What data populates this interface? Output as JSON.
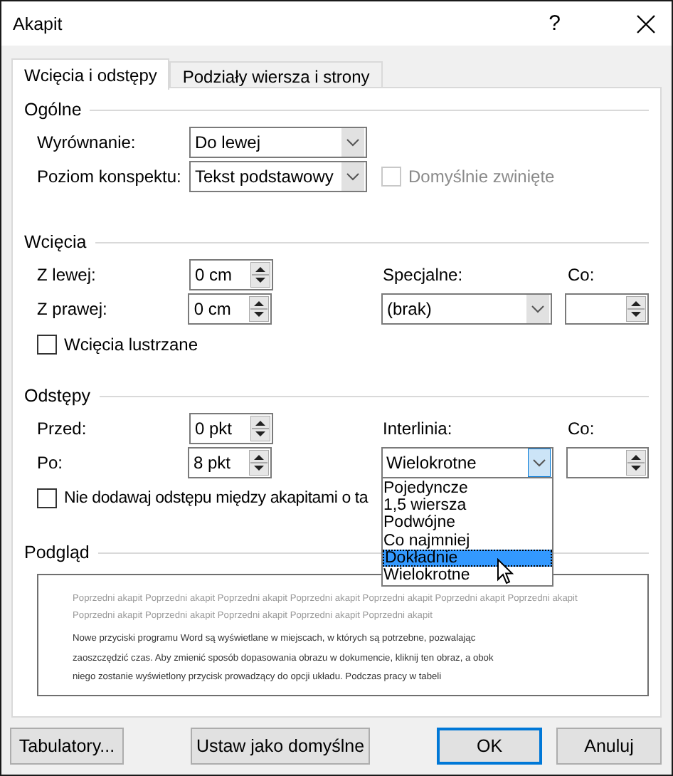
{
  "window": {
    "title": "Akapit",
    "help": "?"
  },
  "tabs": [
    {
      "label": "Wcięcia i odstępy",
      "selected": true
    },
    {
      "label": "Podziały wiersza i strony",
      "selected": false
    }
  ],
  "general": {
    "heading": "Ogólne",
    "alignment": {
      "label": "Wyrównanie:",
      "value": "Do lewej"
    },
    "outline_level": {
      "label": "Poziom konspektu:",
      "value": "Tekst podstawowy"
    },
    "collapsed_by_default": {
      "label": "Domyślnie zwinięte",
      "checked": false,
      "disabled": true
    }
  },
  "indentation": {
    "heading": "Wcięcia",
    "left": {
      "label": "Z lewej:",
      "value": "0 cm"
    },
    "right": {
      "label": "Z prawej:",
      "value": "0 cm"
    },
    "special": {
      "label": "Specjalne:",
      "value": "(brak)"
    },
    "by": {
      "label": "Co:"
    },
    "mirror_indents": {
      "label": "Wcięcia lustrzane",
      "checked": false
    }
  },
  "spacing": {
    "heading": "Odstępy",
    "before": {
      "label": "Przed:",
      "value": "0 pkt"
    },
    "after": {
      "label": "Po:",
      "value": "8 pkt"
    },
    "line_spacing": {
      "label": "Interlinia:",
      "value": "Wielokrotne",
      "expanded": true,
      "options": [
        {
          "label": "Pojedyncze",
          "highlighted": false
        },
        {
          "label": "1,5 wiersza",
          "highlighted": false
        },
        {
          "label": "Podwójne",
          "highlighted": false
        },
        {
          "label": "Co najmniej",
          "highlighted": false
        },
        {
          "label": "Dokładnie",
          "highlighted": true
        },
        {
          "label": "Wielokrotne",
          "highlighted": false
        }
      ]
    },
    "at": {
      "label": "Co:"
    },
    "no_space_same_style": {
      "label": "Nie dodawaj odstępu między akapitami o ta",
      "checked": false
    }
  },
  "preview": {
    "heading": "Podgląd",
    "previous_lines": [
      "Poprzedni akapit Poprzedni akapit Poprzedni akapit Poprzedni akapit Poprzedni akapit Poprzedni akapit Poprzedni akapit",
      "Poprzedni akapit Poprzedni akapit Poprzedni akapit Poprzedni akapit Poprzedni akapit"
    ],
    "current_lines": [
      "Nowe przyciski programu Word są wyświetlane w miejscach, w których są potrzebne, pozwalając",
      "zaoszczędzić czas. Aby zmienić sposób dopasowania obrazu w dokumencie, kliknij ten obraz, a obok",
      "niego zostanie wyświetlony przycisk prowadzący do opcji układu. Podczas pracy w tabeli"
    ]
  },
  "buttons": [
    {
      "label": "Tabulatory...",
      "default": false
    },
    {
      "label": "Ustaw jako domyślne",
      "default": false
    },
    {
      "label": "OK",
      "default": true
    },
    {
      "label": "Anuluj",
      "default": false
    }
  ]
}
